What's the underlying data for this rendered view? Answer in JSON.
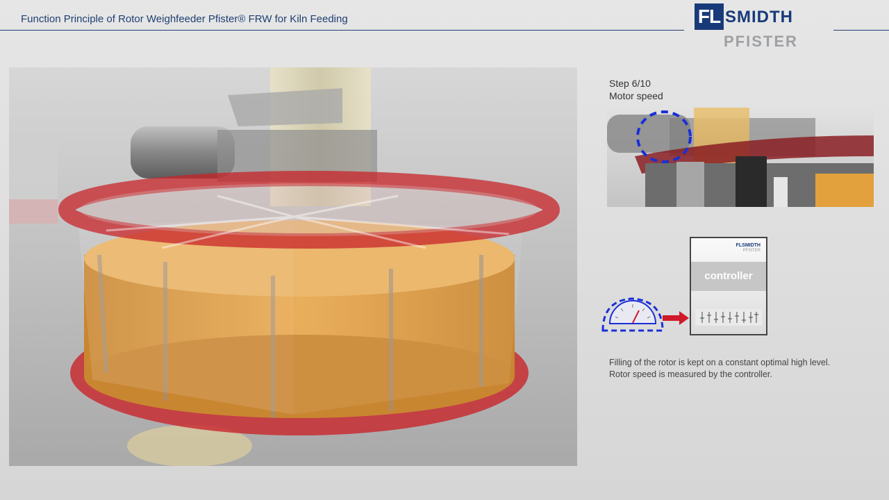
{
  "header": {
    "title": "Function Principle of Rotor Weighfeeder Pfister® FRW for Kiln Feeding"
  },
  "logo": {
    "mark": "FL",
    "word1": "SMIDTH",
    "word2": "PFISTER"
  },
  "step": {
    "counter": "Step 6/10",
    "name": "Motor speed"
  },
  "diagram": {
    "controller_label": "controller",
    "logo_text": "FLSMIDTH",
    "logo_sub": "PFISTER"
  },
  "description": {
    "line1": "Filling of the rotor is kept on a constant optimal high level.",
    "line2": "Rotor speed is measured by the controller."
  },
  "colors": {
    "brand_blue": "#183a79",
    "highlight_blue": "#1a2fd6",
    "arrow_red": "#d01a2a",
    "rotor_red": "#c8242a",
    "material_orange": "#e3a245"
  }
}
